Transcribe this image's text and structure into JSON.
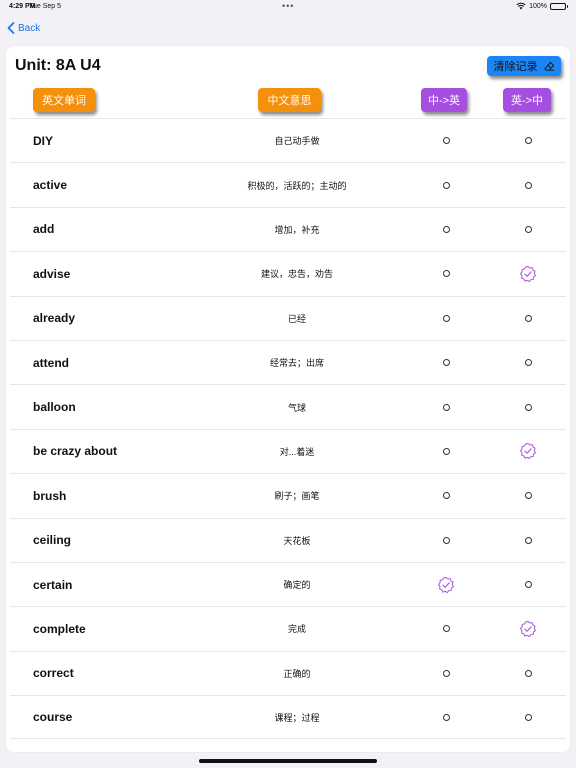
{
  "status_bar": {
    "time": "4:29 PM",
    "date": "Tue Sep 5",
    "dots": "•••",
    "battery_text": "100%"
  },
  "nav": {
    "back_label": "Back"
  },
  "header": {
    "unit_title": "Unit: 8A U4",
    "clear_button_label": "清除记录"
  },
  "columns": {
    "word": "英文单词",
    "meaning": "中文意思",
    "zh_en": "中->英",
    "en_zh": "英->中"
  },
  "colors": {
    "accent_blue": "#1a85f5",
    "header_orange": "#f4900c",
    "header_purple": "#a64ee0",
    "badge_purple": "#a64ee0",
    "back_blue": "#1a73e8"
  },
  "rows": [
    {
      "word": "DIY",
      "meaning": "自己动手做",
      "zh_en": "circle",
      "en_zh": "circle"
    },
    {
      "word": "active",
      "meaning": "积极的，活跃的；主动的",
      "zh_en": "circle",
      "en_zh": "circle"
    },
    {
      "word": "add",
      "meaning": "增加，补充",
      "zh_en": "circle",
      "en_zh": "circle"
    },
    {
      "word": "advise",
      "meaning": "建议，忠告，劝告",
      "zh_en": "circle",
      "en_zh": "check-badge"
    },
    {
      "word": "already",
      "meaning": "已经",
      "zh_en": "circle",
      "en_zh": "circle"
    },
    {
      "word": "attend",
      "meaning": "经常去；出席",
      "zh_en": "circle",
      "en_zh": "circle"
    },
    {
      "word": "balloon",
      "meaning": "气球",
      "zh_en": "circle",
      "en_zh": "circle"
    },
    {
      "word": "be crazy about",
      "meaning": "对...着迷",
      "zh_en": "circle",
      "en_zh": "check-badge"
    },
    {
      "word": "brush",
      "meaning": "刷子；画笔",
      "zh_en": "circle",
      "en_zh": "circle"
    },
    {
      "word": "ceiling",
      "meaning": "天花板",
      "zh_en": "circle",
      "en_zh": "circle"
    },
    {
      "word": "certain",
      "meaning": "确定的",
      "zh_en": "check-badge",
      "en_zh": "circle"
    },
    {
      "word": "complete",
      "meaning": "完成",
      "zh_en": "circle",
      "en_zh": "check-badge"
    },
    {
      "word": "correct",
      "meaning": "正确的",
      "zh_en": "circle",
      "en_zh": "circle"
    },
    {
      "word": "course",
      "meaning": "课程；过程",
      "zh_en": "circle",
      "en_zh": "circle"
    }
  ]
}
